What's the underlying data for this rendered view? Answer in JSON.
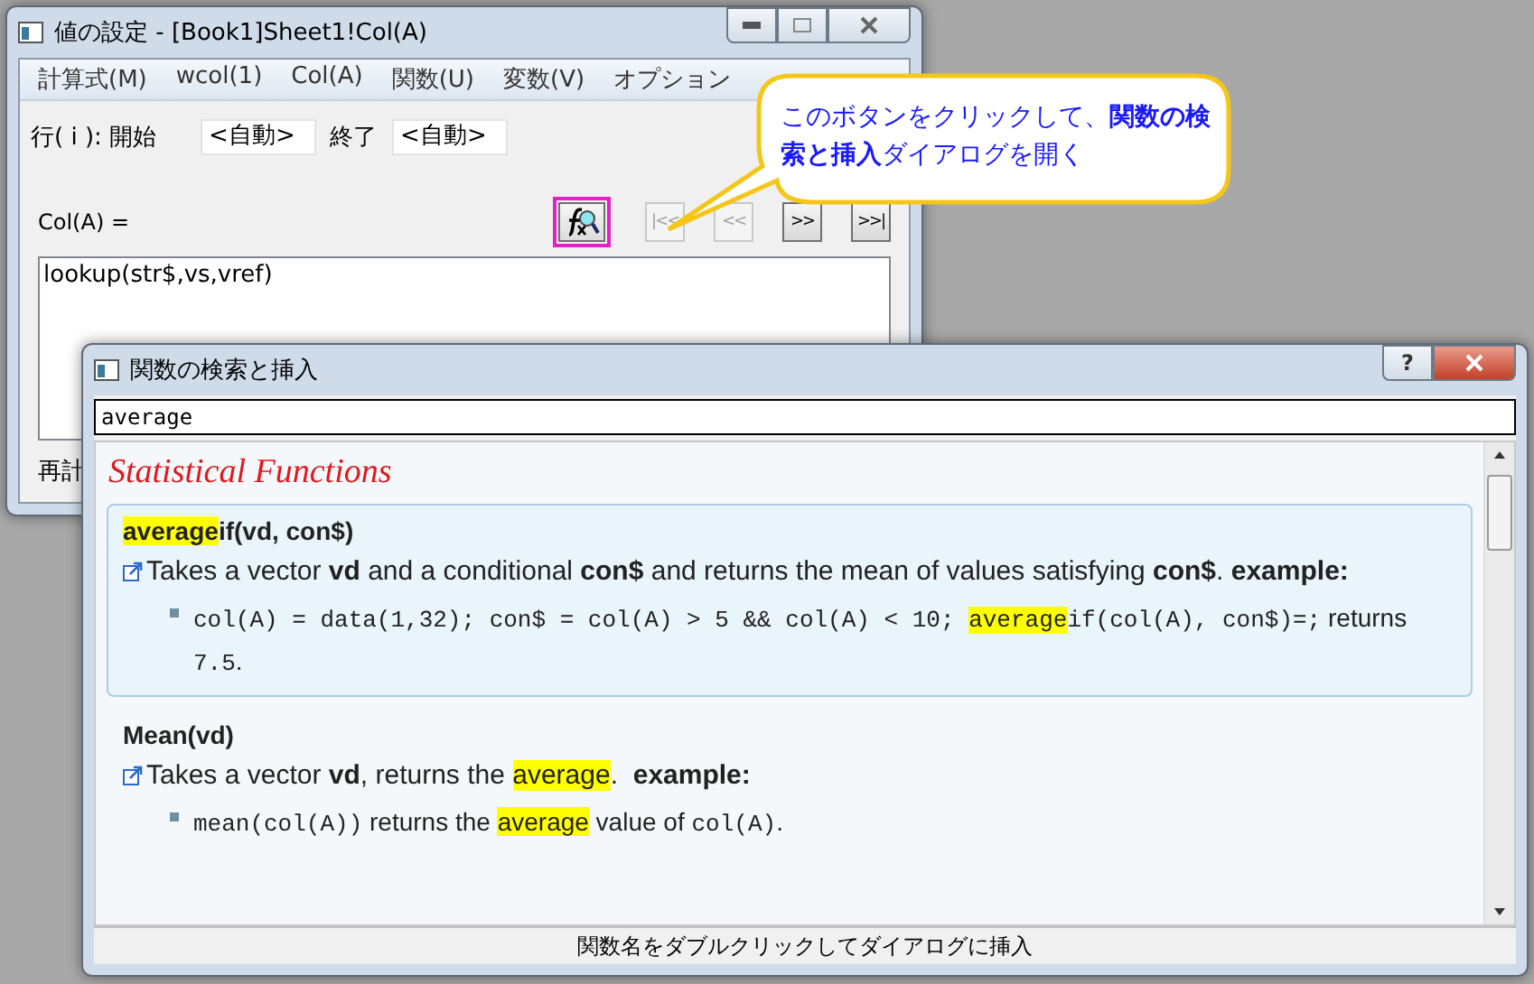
{
  "main_window": {
    "title": "値の設定 - [Book1]Sheet1!Col(A)",
    "menu": [
      "計算式(M)",
      "wcol(1)",
      "Col(A)",
      "関数(U)",
      "変数(V)",
      "オプション"
    ],
    "row_range": {
      "label": "行( i ): 開始",
      "start": "<自動>",
      "end_label": "終了",
      "end": "<自動>"
    },
    "formula_label": "Col(A) =",
    "nav_buttons": [
      {
        "label": "|<<",
        "disabled": true
      },
      {
        "label": "<<",
        "disabled": true
      },
      {
        "label": ">>",
        "disabled": false
      },
      {
        "label": ">>|",
        "disabled": false
      }
    ],
    "formula": "lookup(str$,vs,vref)",
    "recalc_label": "再計"
  },
  "callout": {
    "text": "このボタンをクリックして、**関数の検索と挿入**ダイアログを開く"
  },
  "dialog": {
    "title": "関数の検索と挿入",
    "help_label": "?",
    "search": "average",
    "section_title": "Statistical Functions",
    "entries": [
      {
        "selected": true,
        "signature": [
          {
            "text": "average",
            "kind": "text",
            "highlight": true
          },
          {
            "text": "if(vd, con$)",
            "kind": "text",
            "highlight": false
          }
        ],
        "description": [
          {
            "text": "Takes a vector **vd** and a conditional **con$** and returns the mean of values satisfying **con$**. **example:**",
            "kind": "text",
            "highlight": false
          }
        ],
        "example": [
          {
            "text": "col(A) = data(1,32); con$ = col(A) > 5 && col(A) < 10; ",
            "kind": "code",
            "highlight": false
          },
          {
            "text": "average",
            "kind": "code",
            "highlight": true
          },
          {
            "text": "if(col(A), con$)=;",
            "kind": "code",
            "highlight": false
          },
          {
            "text": " returns ",
            "kind": "text",
            "highlight": false
          },
          {
            "text": "7.5",
            "kind": "code",
            "highlight": false
          },
          {
            "text": ".",
            "kind": "text",
            "highlight": false
          }
        ]
      },
      {
        "selected": false,
        "signature": [
          {
            "text": "Mean(vd)",
            "kind": "text",
            "highlight": false
          }
        ],
        "description": [
          {
            "text": "Takes a vector **vd**, returns the ",
            "kind": "text",
            "highlight": false
          },
          {
            "text": "average",
            "kind": "text",
            "highlight": true
          },
          {
            "text": ".  **example:**",
            "kind": "text",
            "highlight": false
          }
        ],
        "example": [
          {
            "text": "mean(col(A))",
            "kind": "code",
            "highlight": false
          },
          {
            "text": " returns the ",
            "kind": "text",
            "highlight": false
          },
          {
            "text": "average",
            "kind": "text",
            "highlight": true
          },
          {
            "text": " value of ",
            "kind": "text",
            "highlight": false
          },
          {
            "text": "col(A)",
            "kind": "code",
            "highlight": false
          },
          {
            "text": ".",
            "kind": "text",
            "highlight": false
          }
        ]
      }
    ],
    "status": "関数名をダブルクリックしてダイアログに挿入"
  }
}
